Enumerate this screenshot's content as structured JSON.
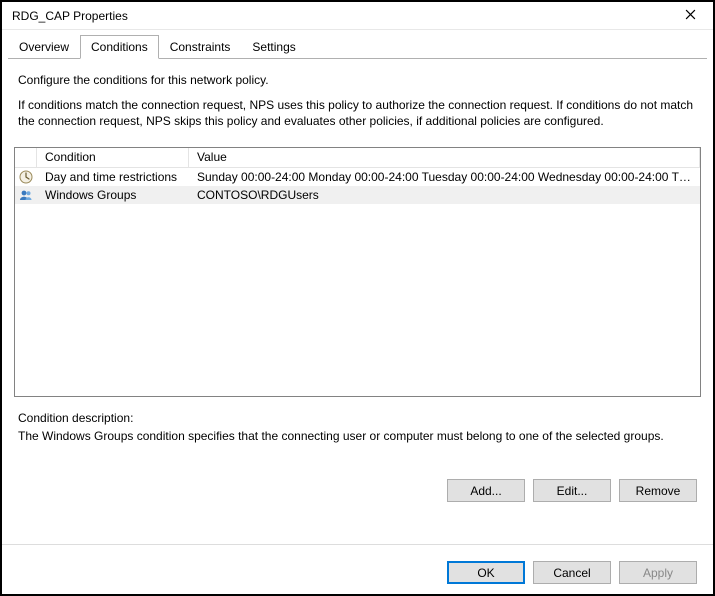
{
  "window": {
    "title": "RDG_CAP Properties"
  },
  "tabs": [
    {
      "label": "Overview"
    },
    {
      "label": "Conditions"
    },
    {
      "label": "Constraints"
    },
    {
      "label": "Settings"
    }
  ],
  "activeTabIndex": 1,
  "intro": {
    "line1": "Configure the conditions for this network policy.",
    "line2": "If conditions match the connection request, NPS uses this policy to authorize the connection request. If conditions do not match the connection request, NPS skips this policy and evaluates other policies, if additional policies are configured."
  },
  "columns": {
    "condition": "Condition",
    "value": "Value"
  },
  "rows": [
    {
      "icon": "clock",
      "condition": "Day and time restrictions",
      "value": "Sunday 00:00-24:00 Monday 00:00-24:00 Tuesday 00:00-24:00 Wednesday 00:00-24:00 Thursd...",
      "selected": false
    },
    {
      "icon": "group",
      "condition": "Windows Groups",
      "value": "CONTOSO\\RDGUsers",
      "selected": true
    }
  ],
  "description": {
    "label": "Condition description:",
    "text": "The Windows Groups condition specifies that the connecting user or computer must belong to one of the selected groups."
  },
  "buttons": {
    "add": "Add...",
    "edit": "Edit...",
    "remove": "Remove",
    "ok": "OK",
    "cancel": "Cancel",
    "apply": "Apply"
  }
}
